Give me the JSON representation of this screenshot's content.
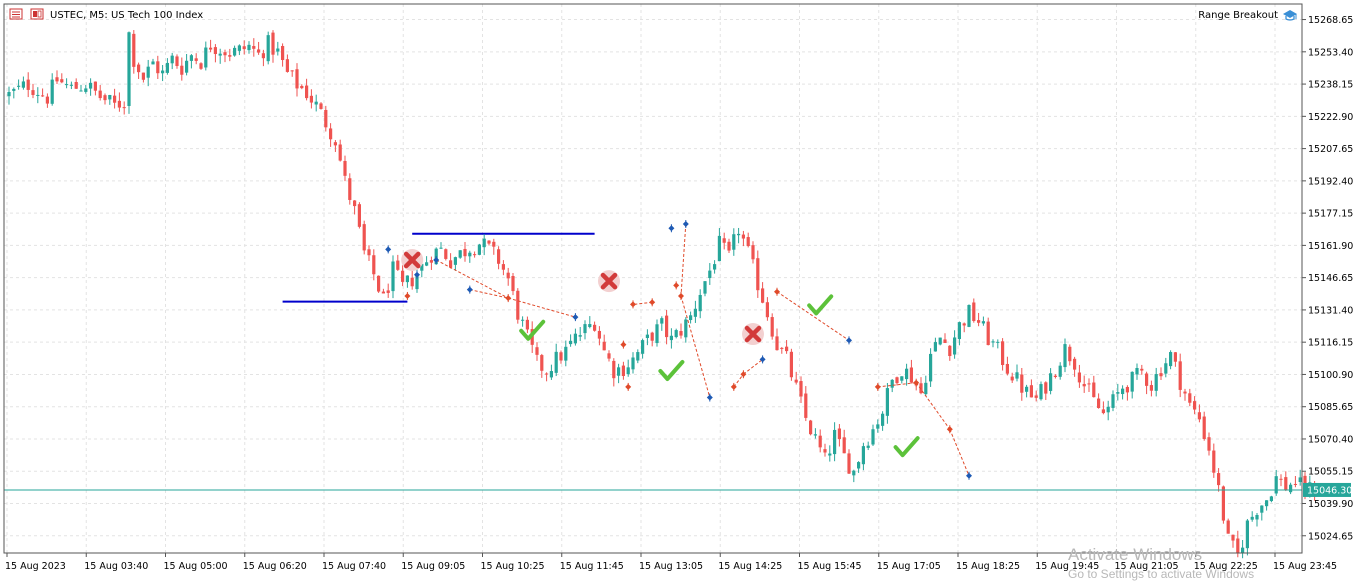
{
  "window": {
    "symbol_title": "USTEC, M5:  US Tech 100 Index",
    "indicator_name": "Range Breakout"
  },
  "colors": {
    "bull": "#26a69a",
    "bear": "#ef5350",
    "grid": "#e3e3e3",
    "price_line": "#26a69a",
    "range_line": "#0000cc",
    "signal_up": "#1e5ab4",
    "signal_down": "#e04a2a",
    "success": "#5cc23a",
    "fail": "#d23a3a"
  },
  "watermark": {
    "line1": "Activate Windows",
    "line2": "Go to Settings to activate Windows"
  },
  "chart_data": {
    "type": "candlestick",
    "title": "USTEC, M5:  US Tech 100 Index",
    "y_ticks": [
      "15268.65",
      "15253.40",
      "15238.15",
      "15222.90",
      "15207.65",
      "15192.40",
      "15177.15",
      "15161.90",
      "15146.65",
      "15131.40",
      "15116.15",
      "15100.90",
      "15085.65",
      "15070.40",
      "15055.15",
      "15039.90",
      "15024.65"
    ],
    "x_ticks": [
      "15 Aug 2023",
      "15 Aug 03:40",
      "15 Aug 05:00",
      "15 Aug 06:20",
      "15 Aug 07:40",
      "15 Aug 09:05",
      "15 Aug 10:25",
      "15 Aug 11:45",
      "15 Aug 13:05",
      "15 Aug 14:25",
      "15 Aug 15:45",
      "15 Aug 17:05",
      "15 Aug 18:25",
      "15 Aug 19:45",
      "15 Aug 21:05",
      "15 Aug 22:25",
      "15 Aug 23:45"
    ],
    "ylim": [
      15016.5,
      15276.0
    ],
    "current_price": 15046.3,
    "current_price_label": "15046.30",
    "grid": true,
    "price_path": [
      [
        0,
        15233
      ],
      [
        4,
        15238
      ],
      [
        6,
        15235
      ],
      [
        8,
        15232
      ],
      [
        10,
        15240
      ],
      [
        13,
        15236
      ],
      [
        16,
        15238
      ],
      [
        19,
        15232
      ],
      [
        22,
        15228
      ],
      [
        24,
        15230
      ],
      [
        25,
        15262
      ],
      [
        26,
        15250
      ],
      [
        28,
        15241
      ],
      [
        30,
        15248
      ],
      [
        32,
        15243
      ],
      [
        34,
        15250
      ],
      [
        36,
        15246
      ],
      [
        38,
        15252
      ],
      [
        40,
        15249
      ],
      [
        42,
        15257
      ],
      [
        44,
        15255
      ],
      [
        46,
        15253
      ],
      [
        48,
        15254
      ],
      [
        50,
        15256
      ],
      [
        52,
        15252
      ],
      [
        54,
        15257
      ],
      [
        56,
        15253
      ],
      [
        58,
        15243
      ],
      [
        60,
        15238
      ],
      [
        62,
        15234
      ],
      [
        64,
        15228
      ],
      [
        66,
        15220
      ],
      [
        68,
        15212
      ],
      [
        70,
        15192
      ],
      [
        72,
        15178
      ],
      [
        74,
        15158
      ],
      [
        76,
        15148
      ],
      [
        78,
        15136
      ],
      [
        80,
        15150
      ],
      [
        82,
        15142
      ],
      [
        84,
        15146
      ],
      [
        86,
        15152
      ],
      [
        88,
        15158
      ],
      [
        90,
        15160
      ],
      [
        92,
        15155
      ],
      [
        94,
        15158
      ],
      [
        96,
        15161
      ],
      [
        98,
        15163
      ],
      [
        100,
        15160
      ],
      [
        102,
        15155
      ],
      [
        104,
        15146
      ],
      [
        106,
        15130
      ],
      [
        108,
        15118
      ],
      [
        110,
        15106
      ],
      [
        112,
        15103
      ],
      [
        114,
        15108
      ],
      [
        116,
        15112
      ],
      [
        118,
        15118
      ],
      [
        120,
        15122
      ],
      [
        122,
        15126
      ],
      [
        124,
        15112
      ],
      [
        126,
        15103
      ],
      [
        128,
        15104
      ],
      [
        130,
        15108
      ],
      [
        132,
        15114
      ],
      [
        134,
        15120
      ],
      [
        136,
        15124
      ],
      [
        138,
        15117
      ],
      [
        140,
        15122
      ],
      [
        142,
        15128
      ],
      [
        144,
        15140
      ],
      [
        146,
        15150
      ],
      [
        148,
        15162
      ],
      [
        150,
        15156
      ],
      [
        152,
        15170
      ],
      [
        154,
        15158
      ],
      [
        156,
        15144
      ],
      [
        158,
        15130
      ],
      [
        160,
        15115
      ],
      [
        162,
        15108
      ],
      [
        164,
        15094
      ],
      [
        166,
        15080
      ],
      [
        168,
        15070
      ],
      [
        170,
        15060
      ],
      [
        172,
        15072
      ],
      [
        174,
        15062
      ],
      [
        176,
        15055
      ],
      [
        178,
        15068
      ],
      [
        180,
        15075
      ],
      [
        182,
        15084
      ],
      [
        184,
        15098
      ],
      [
        186,
        15104
      ],
      [
        188,
        15100
      ],
      [
        190,
        15092
      ],
      [
        192,
        15110
      ],
      [
        194,
        15118
      ],
      [
        196,
        15114
      ],
      [
        198,
        15124
      ],
      [
        200,
        15130
      ],
      [
        202,
        15126
      ],
      [
        204,
        15118
      ],
      [
        206,
        15112
      ],
      [
        208,
        15104
      ],
      [
        210,
        15098
      ],
      [
        212,
        15092
      ],
      [
        214,
        15089
      ],
      [
        216,
        15096
      ],
      [
        218,
        15104
      ],
      [
        220,
        15113
      ],
      [
        222,
        15107
      ],
      [
        224,
        15096
      ],
      [
        226,
        15088
      ],
      [
        228,
        15082
      ],
      [
        230,
        15088
      ],
      [
        232,
        15095
      ],
      [
        234,
        15098
      ],
      [
        236,
        15102
      ],
      [
        238,
        15096
      ],
      [
        240,
        15104
      ],
      [
        242,
        15110
      ],
      [
        244,
        15098
      ],
      [
        246,
        15086
      ],
      [
        248,
        15080
      ],
      [
        250,
        15066
      ],
      [
        252,
        15046
      ],
      [
        254,
        15022
      ],
      [
        256,
        15015
      ],
      [
        258,
        15030
      ],
      [
        260,
        15038
      ],
      [
        262,
        15042
      ],
      [
        264,
        15052
      ],
      [
        266,
        15048
      ],
      [
        268,
        15050
      ],
      [
        270,
        15046
      ],
      [
        272,
        15047
      ]
    ],
    "range_lines": [
      {
        "from_bar": 57,
        "to_bar": 83,
        "price": 15135.3
      },
      {
        "from_bar": 84,
        "to_bar": 122,
        "price": 15167.4
      }
    ],
    "signals": [
      {
        "bar": 79,
        "price": 15160,
        "dir": "up"
      },
      {
        "bar": 83,
        "price": 15138,
        "dir": "down"
      },
      {
        "bar": 85,
        "price": 15148,
        "dir": "up"
      },
      {
        "bar": 89,
        "price": 15155,
        "dir": "up"
      },
      {
        "bar": 96,
        "price": 15141,
        "dir": "up"
      },
      {
        "bar": 104,
        "price": 15137,
        "dir": "down"
      },
      {
        "bar": 118,
        "price": 15128,
        "dir": "up"
      },
      {
        "bar": 128,
        "price": 15115,
        "dir": "down"
      },
      {
        "bar": 129,
        "price": 15095,
        "dir": "down"
      },
      {
        "bar": 130,
        "price": 15134,
        "dir": "down"
      },
      {
        "bar": 134,
        "price": 15135,
        "dir": "down"
      },
      {
        "bar": 138,
        "price": 15170,
        "dir": "up"
      },
      {
        "bar": 139,
        "price": 15143,
        "dir": "down"
      },
      {
        "bar": 140,
        "price": 15138,
        "dir": "down"
      },
      {
        "bar": 141,
        "price": 15172,
        "dir": "up"
      },
      {
        "bar": 146,
        "price": 15090,
        "dir": "up"
      },
      {
        "bar": 151,
        "price": 15095,
        "dir": "down"
      },
      {
        "bar": 153,
        "price": 15101,
        "dir": "down"
      },
      {
        "bar": 157,
        "price": 15108,
        "dir": "up"
      },
      {
        "bar": 160,
        "price": 15140,
        "dir": "down"
      },
      {
        "bar": 175,
        "price": 15117,
        "dir": "up"
      },
      {
        "bar": 181,
        "price": 15095,
        "dir": "down"
      },
      {
        "bar": 189,
        "price": 15097,
        "dir": "down"
      },
      {
        "bar": 196,
        "price": 15075,
        "dir": "down"
      },
      {
        "bar": 200,
        "price": 15053,
        "dir": "up"
      }
    ],
    "signal_links": [
      {
        "from_bar": 89,
        "from_price": 15155,
        "to_bar": 104,
        "to_price": 15137
      },
      {
        "from_bar": 96,
        "from_price": 15141,
        "to_bar": 104,
        "to_price": 15137
      },
      {
        "from_bar": 104,
        "from_price": 15137,
        "to_bar": 118,
        "to_price": 15128
      },
      {
        "from_bar": 134,
        "from_price": 15135,
        "to_bar": 130,
        "to_price": 15134
      },
      {
        "from_bar": 141,
        "from_price": 15172,
        "to_bar": 140,
        "to_price": 15138
      },
      {
        "from_bar": 140,
        "from_price": 15138,
        "to_bar": 146,
        "to_price": 15090
      },
      {
        "from_bar": 151,
        "from_price": 15095,
        "to_bar": 153,
        "to_price": 15101
      },
      {
        "from_bar": 153,
        "from_price": 15101,
        "to_bar": 157,
        "to_price": 15108
      },
      {
        "from_bar": 160,
        "from_price": 15140,
        "to_bar": 175,
        "to_price": 15117
      },
      {
        "from_bar": 181,
        "from_price": 15095,
        "to_bar": 189,
        "to_price": 15097
      },
      {
        "from_bar": 189,
        "from_price": 15097,
        "to_bar": 196,
        "to_price": 15075
      },
      {
        "from_bar": 196,
        "from_price": 15075,
        "to_bar": 200,
        "to_price": 15053
      }
    ],
    "outcomes": [
      {
        "bar": 84,
        "price": 15155,
        "result": "fail"
      },
      {
        "bar": 109,
        "price": 15122,
        "result": "success"
      },
      {
        "bar": 125,
        "price": 15145,
        "result": "fail"
      },
      {
        "bar": 138,
        "price": 15103,
        "result": "success"
      },
      {
        "bar": 155,
        "price": 15120,
        "result": "fail"
      },
      {
        "bar": 169,
        "price": 15134,
        "result": "success"
      },
      {
        "bar": 187,
        "price": 15067,
        "result": "success"
      }
    ]
  }
}
